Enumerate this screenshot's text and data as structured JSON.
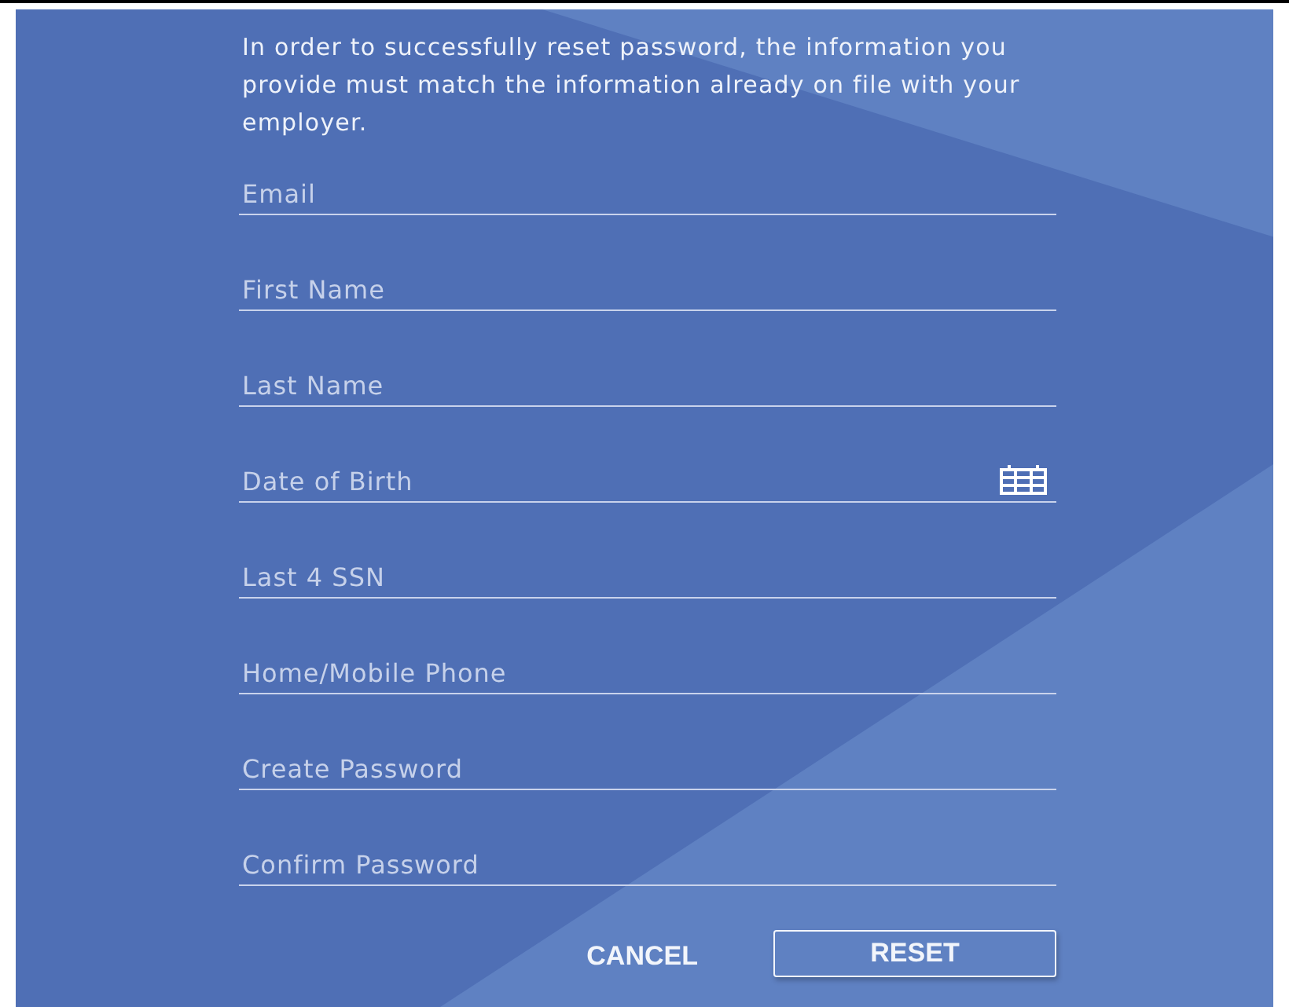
{
  "intro": "In order to successfully reset password, the information you provide must match the information already on file with your employer.",
  "fields": [
    {
      "placeholder": "Email",
      "kind": "text"
    },
    {
      "placeholder": "First Name",
      "kind": "text"
    },
    {
      "placeholder": "Last Name",
      "kind": "text"
    },
    {
      "placeholder": "Date of Birth",
      "kind": "date"
    },
    {
      "placeholder": "Last 4 SSN",
      "kind": "text"
    },
    {
      "placeholder": "Home/Mobile Phone",
      "kind": "text"
    },
    {
      "placeholder": "Create Password",
      "kind": "password"
    },
    {
      "placeholder": "Confirm Password",
      "kind": "password"
    }
  ],
  "buttons": [
    {
      "label": "CANCEL",
      "kind": "flat"
    },
    {
      "label": "RESET",
      "kind": "outlined"
    }
  ]
}
